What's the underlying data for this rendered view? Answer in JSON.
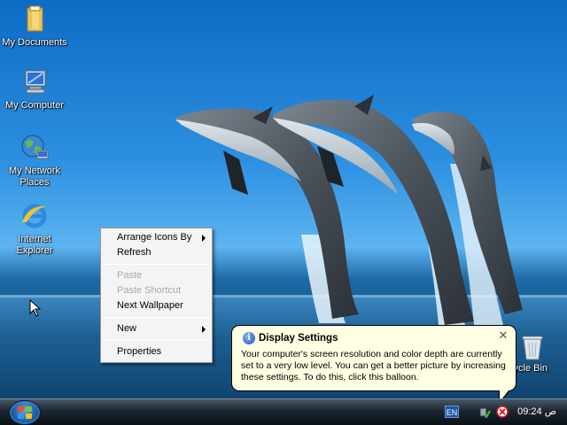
{
  "desktop": {
    "icons": [
      {
        "label": "My Documents"
      },
      {
        "label": "My Computer"
      },
      {
        "label": "My Network Places"
      },
      {
        "label": "Internet Explorer"
      },
      {
        "label": "cycle Bin"
      }
    ]
  },
  "context_menu": {
    "items": [
      {
        "label": "Arrange Icons By",
        "enabled": true,
        "submenu": true
      },
      {
        "label": "Refresh",
        "enabled": true
      },
      {
        "label": "Paste",
        "enabled": false
      },
      {
        "label": "Paste Shortcut",
        "enabled": false
      },
      {
        "label": "Next Wallpaper",
        "enabled": true
      },
      {
        "label": "New",
        "enabled": true,
        "submenu": true
      },
      {
        "label": "Properties",
        "enabled": true
      }
    ]
  },
  "balloon": {
    "title": "Display Settings",
    "body": "Your computer's screen resolution and color depth are currently set to a very low level. You can get a better picture by increasing these settings. To do this, click this balloon.",
    "close_glyph": "✕"
  },
  "taskbar": {
    "language": "EN",
    "clock": "09:24 ص"
  },
  "colors": {
    "balloon_bg": "#ffffe1",
    "menu_bg": "#f4f4f4",
    "disabled_text": "#a8a8a8"
  }
}
